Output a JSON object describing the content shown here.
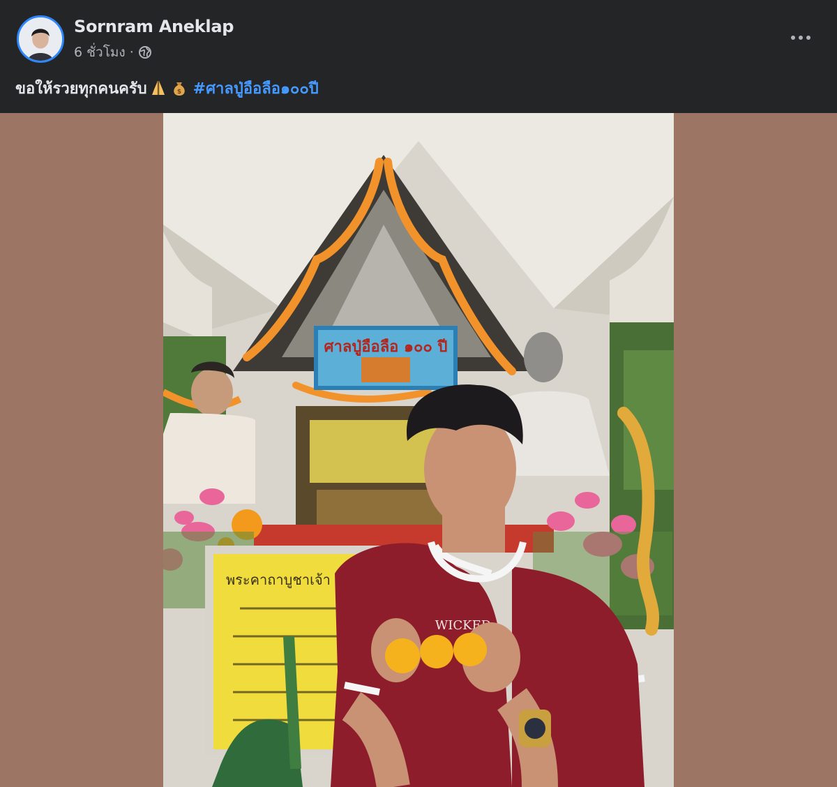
{
  "post": {
    "author_name": "Sornram Aneklap",
    "timestamp": "6 ชั่วโมง",
    "separator": "·",
    "privacy_icon": "globe-icon",
    "more_icon": "more-options-icon",
    "caption_text": "ขอให้รวยทุกคนครับ",
    "caption_emojis": [
      "folded-hands-emoji",
      "money-bag-emoji"
    ],
    "hashtag": "#ศาลปู่อือลือ๑๐๐ปี"
  },
  "photo": {
    "shrine_sign_text": "ศาลปู่อือลือ ๑๐๐ ปี",
    "plaque_title": "พระคาถาบูชาเจ้า",
    "shirt_text": "WICKED"
  },
  "colors": {
    "background": "#242526",
    "photo_backdrop": "#9d7565",
    "hashtag": "#4599ff",
    "text_primary": "#e4e6eb",
    "text_secondary": "#b0b3b8",
    "avatar_ring": "#2d88ff"
  }
}
